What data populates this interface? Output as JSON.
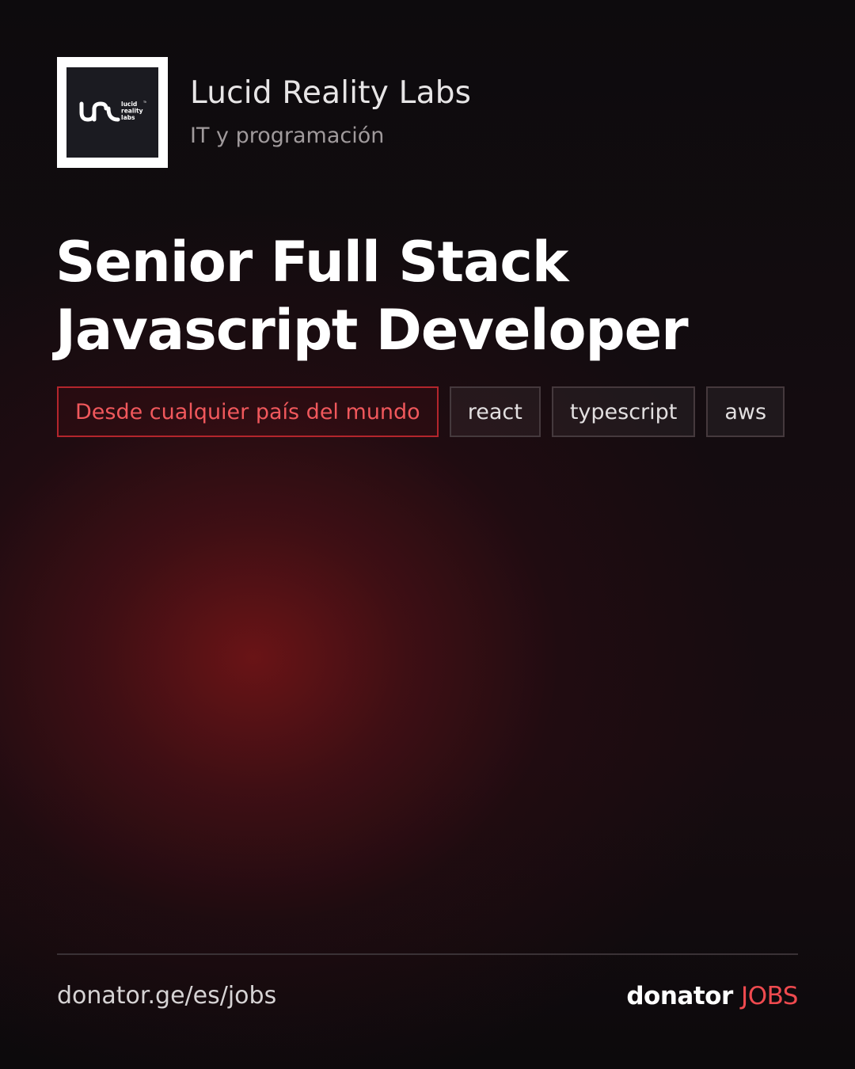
{
  "company": {
    "name": "Lucid Reality Labs",
    "category": "IT y programación",
    "logo_text": [
      "lucid",
      "reality",
      "labs"
    ]
  },
  "job": {
    "title_line1": "Senior Full Stack",
    "title_line2": "Javascript Developer"
  },
  "tags": {
    "location": "Desde cualquier país del mundo",
    "skills": [
      "react",
      "typescript",
      "aws"
    ]
  },
  "footer": {
    "url": "donator.ge/es/jobs",
    "brand_word": "donator",
    "brand_accent": "JOBS"
  },
  "colors": {
    "accent": "#ef4a4f",
    "location_tag_border": "#b3252c",
    "background": "#0e0b0d"
  }
}
